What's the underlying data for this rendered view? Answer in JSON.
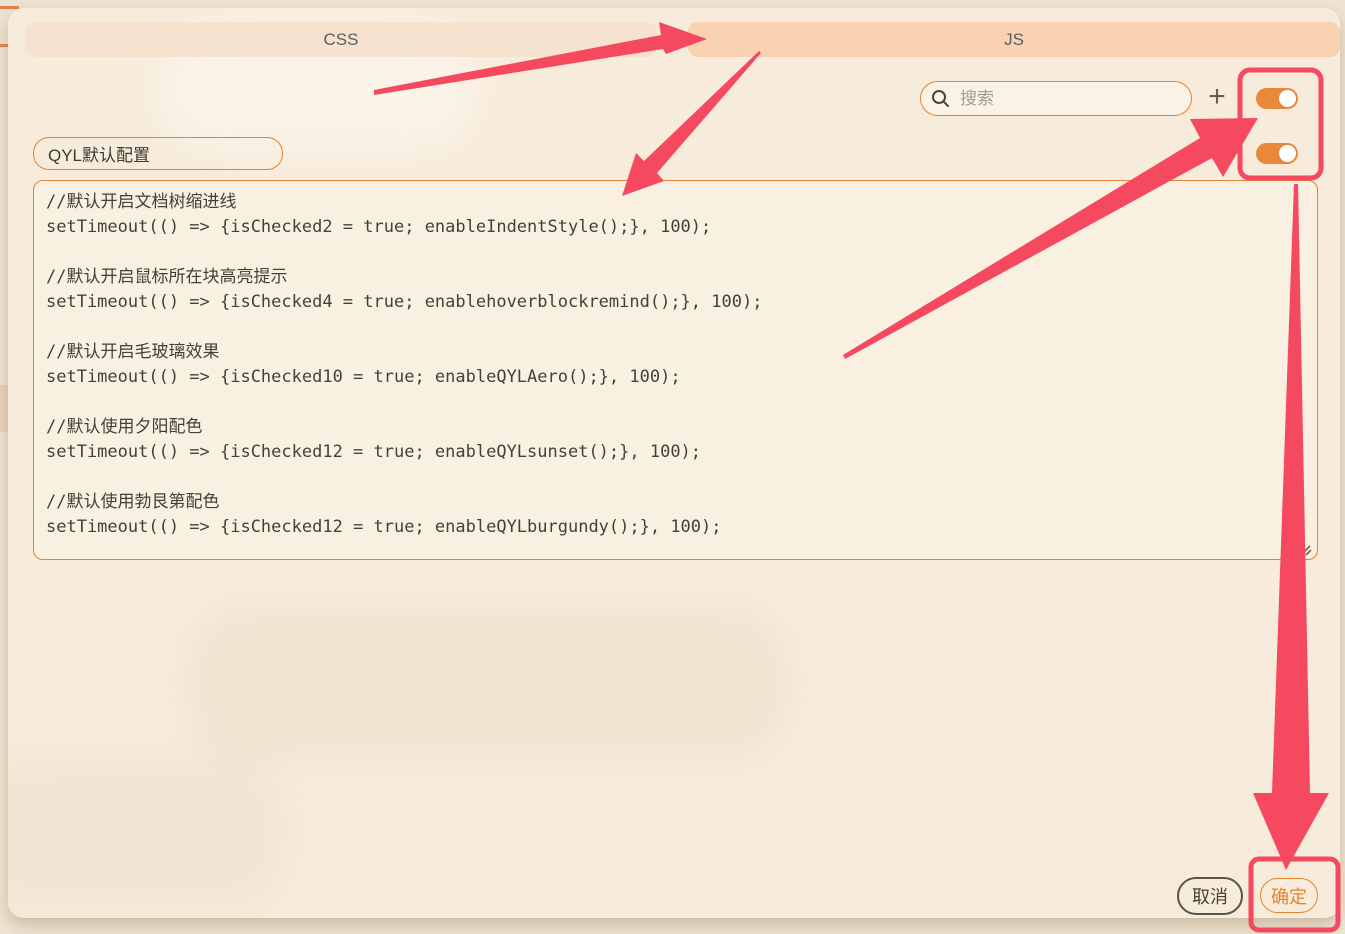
{
  "colors": {
    "page-bg": "#eee4d3",
    "dialog-bg": "#f7ecdc",
    "tab-bg": "#f5e3d0",
    "tab-active-bg": "#f9d2b1",
    "tab-text": "#5a5c63",
    "accent": "#e8883a",
    "accent-border": "#e08434",
    "code-bg": "#faf0e1",
    "code-text": "#443f38",
    "placeholder": "#a29c90",
    "annotation": "#f5495f",
    "confirm": "#e2862c"
  },
  "tabs": {
    "css_label": "CSS",
    "js_label": "JS",
    "active_tab": "JS"
  },
  "toolbar": {
    "search_placeholder": "搜索",
    "add_label": "+"
  },
  "toggles": {
    "toggle1_state": "on",
    "toggle2_state": "on"
  },
  "config": {
    "name_value": "QYL默认配置"
  },
  "editor": {
    "code": "//默认开启文档树缩进线\nsetTimeout(() => {isChecked2 = true; enableIndentStyle();}, 100);\n\n//默认开启鼠标所在块高亮提示\nsetTimeout(() => {isChecked4 = true; enablehoverblockremind();}, 100);\n\n//默认开启毛玻璃效果\nsetTimeout(() => {isChecked10 = true; enableQYLAero();}, 100);\n\n//默认使用夕阳配色\nsetTimeout(() => {isChecked12 = true; enableQYLsunset();}, 100);\n\n//默认使用勃艮第配色\nsetTimeout(() => {isChecked12 = true; enableQYLburgundy();}, 100);"
  },
  "footer": {
    "cancel_label": "取消",
    "confirm_label": "确定"
  }
}
